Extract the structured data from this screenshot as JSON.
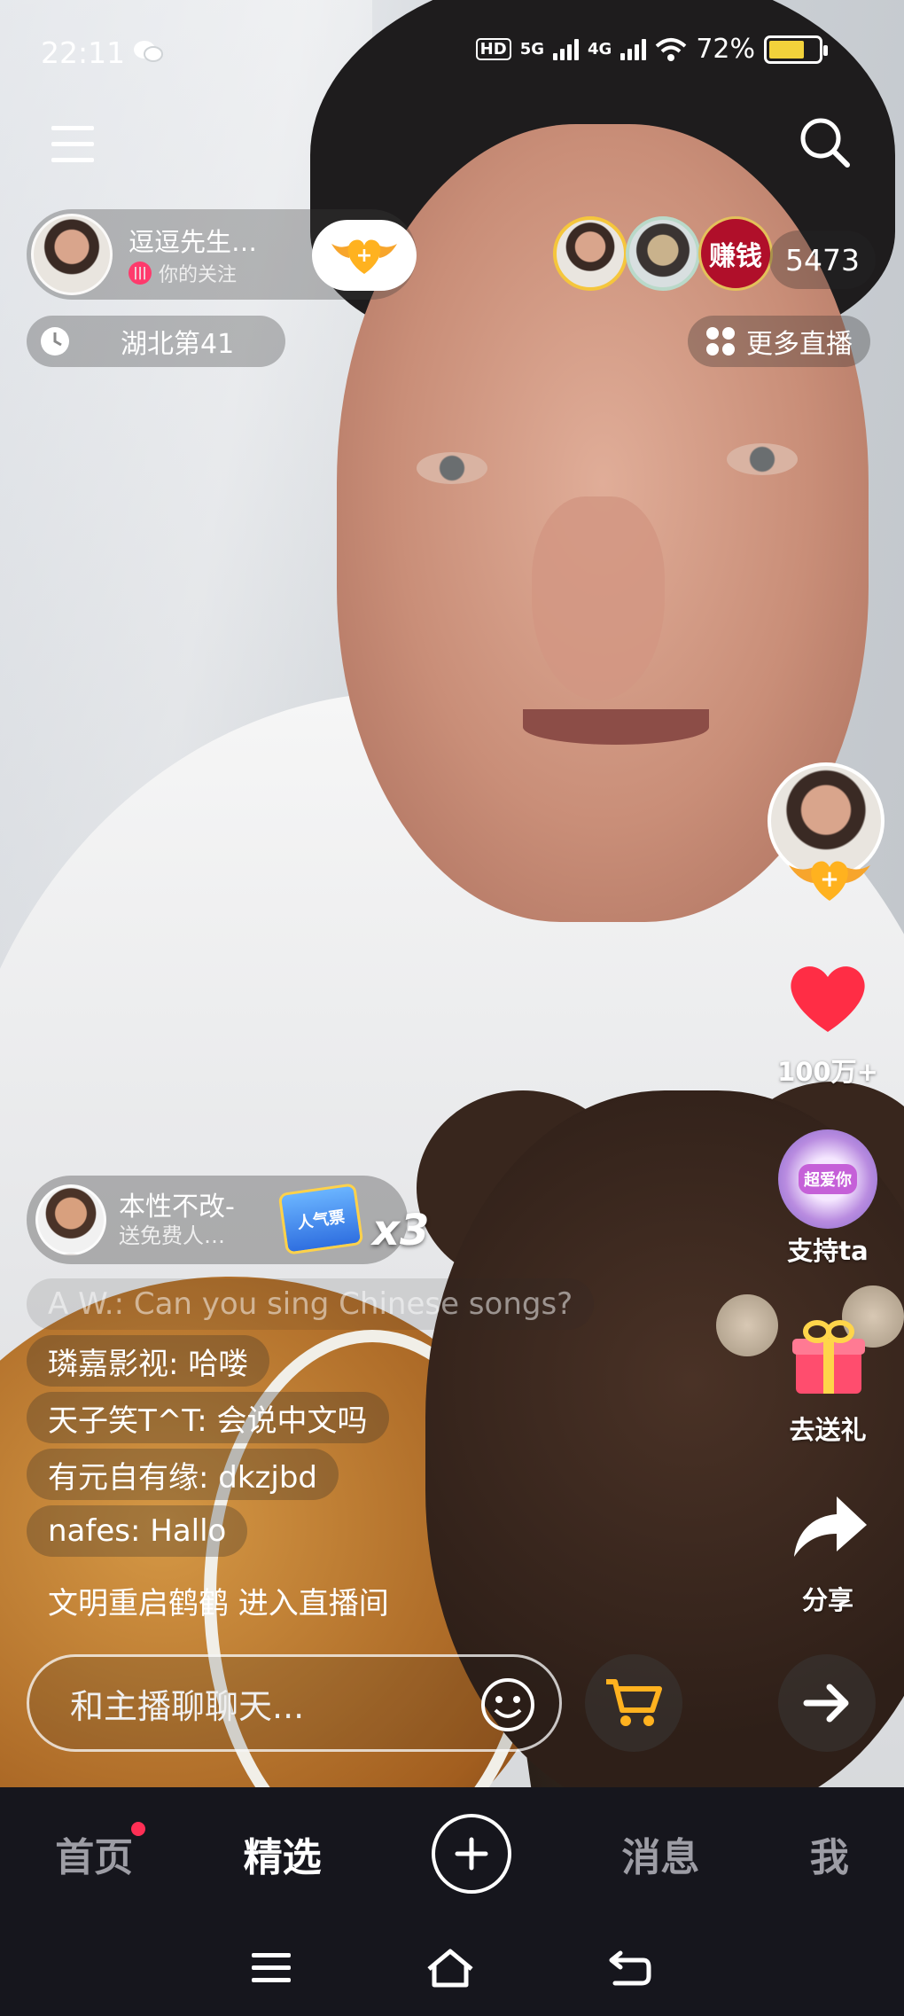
{
  "status_bar": {
    "time": "22:11",
    "hd_label": "HD",
    "net1": "5G",
    "net2": "4G",
    "battery": "72%"
  },
  "anchor": {
    "name": "逗逗先生…",
    "subtitle": "你的关注",
    "rank": "湖北第41"
  },
  "viewers": {
    "earn_label": "赚钱",
    "count": "5473"
  },
  "more_live": "更多直播",
  "right_column": {
    "likes": "100万+",
    "support": "支持ta",
    "support_badge": "超爱你",
    "gift": "去送礼",
    "share": "分享"
  },
  "gift_notice": {
    "user": "本性不改-",
    "action": "送免费人…",
    "multiplier": "x3",
    "gift_badge": "人气票"
  },
  "chat": [
    {
      "text": "A W.: Can you sing Chinese songs?",
      "faded": true
    },
    {
      "text": "璘嘉影视: 哈喽",
      "faded": false
    },
    {
      "text": "天子笑T^T: 会说中文吗",
      "faded": false
    },
    {
      "text": "有元自有缘: dkzjbd",
      "faded": false
    },
    {
      "text": "nafes: Hallo",
      "faded": false
    },
    {
      "text": "文明重启鹤鹤 进入直播间",
      "faded": false
    }
  ],
  "input": {
    "placeholder": "和主播聊聊天..."
  },
  "bottom_nav": {
    "home": "首页",
    "featured": "精选",
    "messages": "消息",
    "me": "我"
  },
  "colors": {
    "heart": "#ff2d45",
    "accent_gold": "#f5c63c",
    "nav_bg": "#16161d"
  }
}
